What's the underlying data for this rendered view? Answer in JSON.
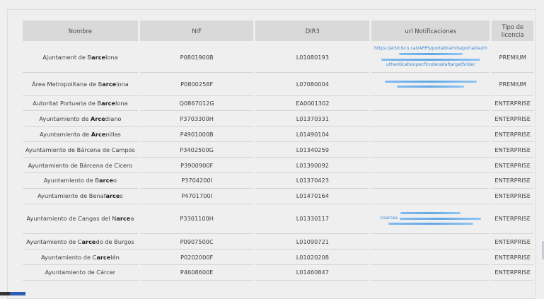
{
  "table": {
    "headers": [
      "Nombre",
      "NIF",
      "DIR3",
      "url Notificaciones",
      "Tipo de licencia"
    ],
    "rows": [
      {
        "pre": "Ajuntament de B",
        "hl": "arce",
        "post": "lona",
        "nif": "P0801900B",
        "dir3": "L01080193",
        "url": [
          "https://w30.bcn.cat/APPS/portaltramits/portal/auth",
          "",
          "uthenticationpecficoderadaltargetfolder"
        ],
        "tipo": "PREMIUM"
      },
      {
        "pre": "Àrea Metropolitana de B",
        "hl": "arce",
        "post": "lona",
        "nif": "P0800258F",
        "dir3": "L07080004",
        "url": [],
        "tipo": "PREMIUM"
      },
      {
        "pre": "Autoritat Portuaria de B",
        "hl": "arce",
        "post": "lona",
        "nif": "Q0867012G",
        "dir3": "EA0001302",
        "url": [],
        "tipo": "ENTERPRISE"
      },
      {
        "pre": "Ayuntamiento de ",
        "hl": "Arce",
        "post": "diano",
        "nif": "P3703300H",
        "dir3": "L01370331",
        "url": [],
        "tipo": "ENTERPRISE"
      },
      {
        "pre": "Ayuntamiento de ",
        "hl": "Arce",
        "post": "nillas",
        "nif": "P4901000B",
        "dir3": "L01490104",
        "url": [],
        "tipo": "ENTERPRISE"
      },
      {
        "pre": "Ayuntamiento de Bárcena de Campos",
        "hl": "",
        "post": "",
        "nif": "P3402500G",
        "dir3": "L01340259",
        "url": [],
        "tipo": "ENTERPRISE"
      },
      {
        "pre": "Ayuntamiento de Bárcena de Cicero",
        "hl": "",
        "post": "",
        "nif": "P3900900F",
        "dir3": "L01390092",
        "url": [],
        "tipo": "ENTERPRISE"
      },
      {
        "pre": "Ayuntamiento de B",
        "hl": "arce",
        "post": "o",
        "nif": "P3704200I",
        "dir3": "L01370423",
        "url": [],
        "tipo": "ENTERPRISE"
      },
      {
        "pre": "Ayuntamiento de Benaf",
        "hl": "arce",
        "post": "s",
        "nif": "P4701700I",
        "dir3": "L01470164",
        "url": [],
        "tipo": "ENTERPRISE"
      },
      {
        "pre": "Ayuntamiento de Cangas del N",
        "hl": "arce",
        "post": "a",
        "nif": "P3301100H",
        "dir3": "L01330117",
        "url": [
          "cnarcea"
        ],
        "tipo": "ENTERPRISE"
      },
      {
        "pre": "Ayuntamiento de C",
        "hl": "arce",
        "post": "do de Burgos",
        "nif": "P0907500C",
        "dir3": "L01090721",
        "url": [],
        "tipo": "ENTERPRISE"
      },
      {
        "pre": "Ayuntamiento de C",
        "hl": "arce",
        "post": "lén",
        "nif": "P0202000F",
        "dir3": "L01020208",
        "url": [],
        "tipo": "ENTERPRISE"
      },
      {
        "pre": "Ayuntamiento de Cárcer",
        "hl": "",
        "post": "",
        "nif": "P4608600E",
        "dir3": "L01460847",
        "url": [],
        "tipo": "ENTERPRISE"
      }
    ]
  }
}
